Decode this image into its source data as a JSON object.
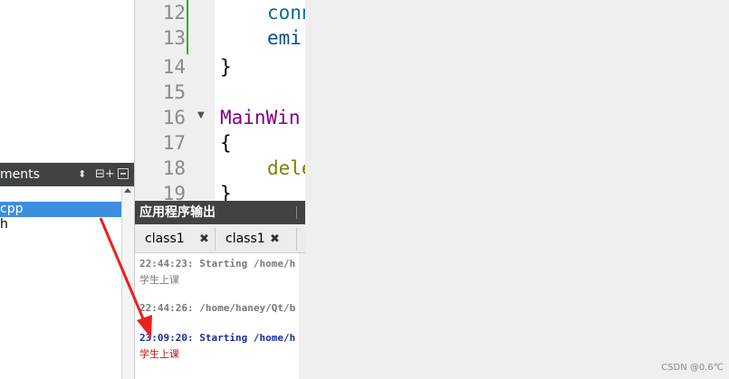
{
  "open_documents": {
    "title": "ments",
    "items": [
      {
        "label": "cpp",
        "selected": true
      },
      {
        "label": "h",
        "selected": false
      }
    ]
  },
  "editor": {
    "lines": [
      {
        "number": "12",
        "code": "conn",
        "color": "#0b6e8a"
      },
      {
        "number": "13",
        "code": "emi",
        "color": "#0b4f8a"
      },
      {
        "number": "14",
        "code": "}",
        "color": "#000000"
      },
      {
        "number": "15",
        "code": "",
        "color": "#000000"
      },
      {
        "number": "16",
        "code": "MainWin",
        "color": "#800080"
      },
      {
        "number": "17",
        "code": "{",
        "color": "#000000"
      },
      {
        "number": "18",
        "code": "dele",
        "color": "#808000"
      },
      {
        "number": "19",
        "code": "}",
        "color": "#000000"
      }
    ]
  },
  "output_pane": {
    "title": "应用程序输出",
    "tabs": [
      {
        "label": "class1",
        "close": "✖"
      },
      {
        "label": "class1",
        "close": "✖"
      }
    ],
    "lines": [
      {
        "text": "22:44:23: Starting /home/h",
        "style": "grey"
      },
      {
        "text": "学生上课",
        "style": "grey-plain"
      },
      {
        "text": "22:44:26: /home/haney/Qt/b",
        "style": "grey"
      },
      {
        "text": "23:09:20: Starting /home/h",
        "style": "blue"
      },
      {
        "text": "学生上课",
        "style": "red"
      }
    ]
  },
  "watermark": "CSDN @0.6℃",
  "colors": {
    "selection": "#3d8ee0",
    "panel_header": "#404244",
    "arrow": "#e8231f"
  }
}
